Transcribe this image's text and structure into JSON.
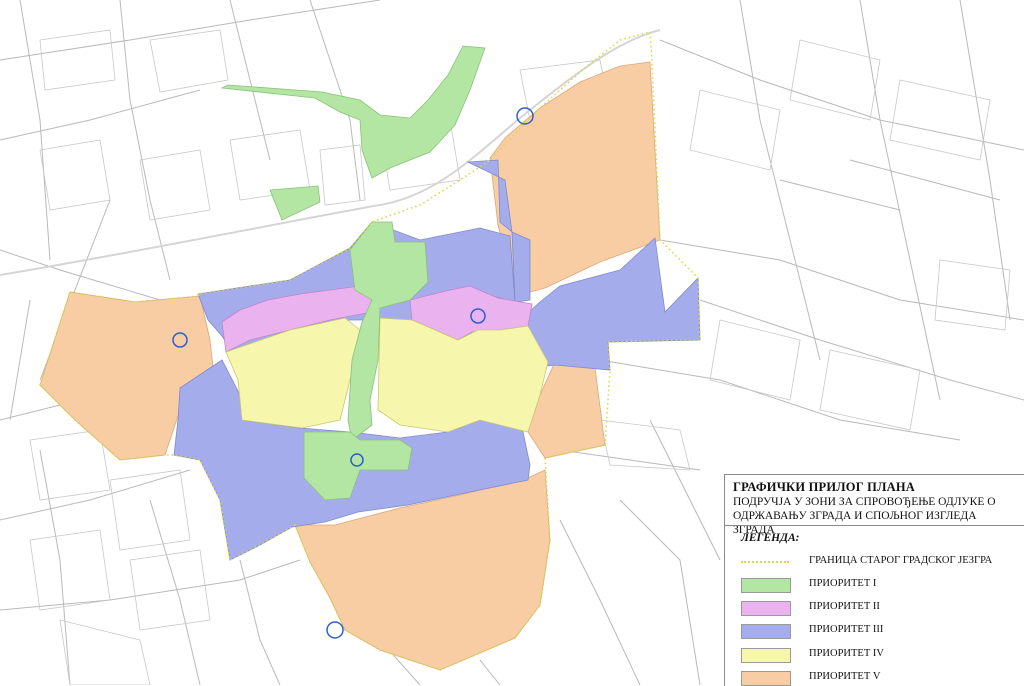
{
  "colors": {
    "priority_1": "#b3e6a2",
    "priority_2": "#ebb2f0",
    "priority_3": "#a4acec",
    "priority_4": "#f7f6ad",
    "priority_5": "#f8cda4",
    "boundary": "#d8d84a",
    "marker": "#2b5fd0",
    "street_lines": "#b9b9b9"
  },
  "legend": {
    "title": "ГРАФИЧКИ ПРИЛОГ ПЛАНА",
    "subtitle": "ПОДРУЧЈА У ЗОНИ ЗА СПРОВОЂЕЊЕ ОДЛУКЕ О ОДРЖАВАЊУ ЗГРАДА И СПОЉНОГ ИЗГЛЕДА ЗГРАДА",
    "heading": "ЛЕГЕНДА:",
    "items": [
      {
        "label": "ГРАНИЦА СТАРОГ ГРАДСКОГ ЈЕЗГРА",
        "swatch": "boundary-line"
      },
      {
        "label": "ПРИОРИТЕТ I",
        "swatch": "priority_1"
      },
      {
        "label": "ПРИОРИТЕТ II",
        "swatch": "priority_2"
      },
      {
        "label": "ПРИОРИТЕТ III",
        "swatch": "priority_3"
      },
      {
        "label": "ПРИОРИТЕТ IV",
        "swatch": "priority_4"
      },
      {
        "label": "ПРИОРИТЕТ V",
        "swatch": "priority_5"
      }
    ]
  }
}
